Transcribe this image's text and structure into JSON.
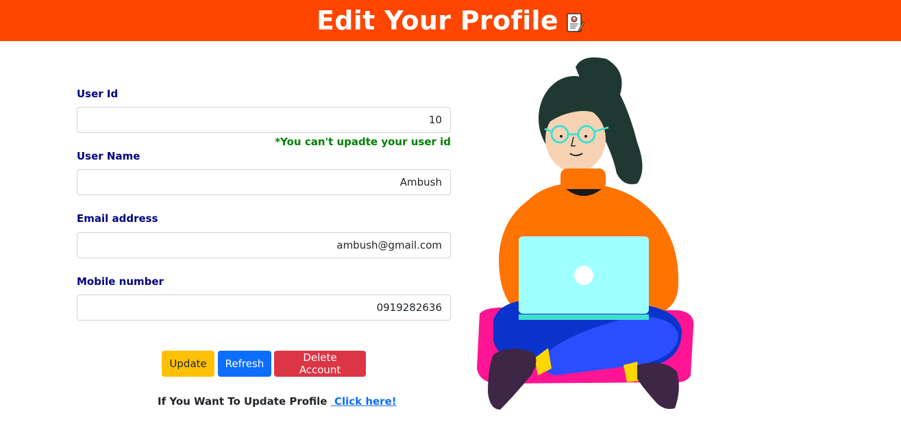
{
  "header": {
    "title": "Edit Your Profile",
    "icon": "profile-document-icon"
  },
  "form": {
    "user_id": {
      "label": "User Id",
      "value": "10"
    },
    "user_id_note": "*You can't upadte your user id",
    "user_name": {
      "label": "User Name",
      "value": "Ambush"
    },
    "email": {
      "label": "Email address",
      "value": "ambush@gmail.com"
    },
    "mobile": {
      "label": "Mobile number",
      "value": "0919282636"
    }
  },
  "buttons": {
    "update": "Update",
    "refresh": "Refresh",
    "delete": "Delete Account"
  },
  "footer": {
    "text": "If You Want To Update Profile",
    "link": "Click here!"
  },
  "colors": {
    "header_bg": "#ff4500",
    "label": "#000080",
    "note": "#008000",
    "update": "#ffc107",
    "refresh": "#0d6efd",
    "delete": "#dc3545"
  }
}
